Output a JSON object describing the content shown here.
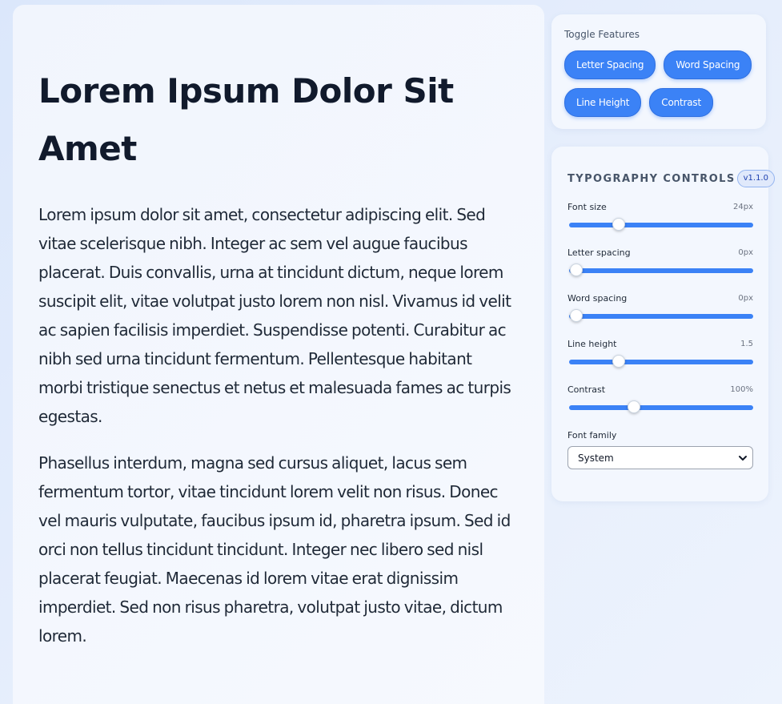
{
  "article": {
    "title": "Lorem Ipsum Dolor Sit Amet",
    "paragraphs": [
      "Lorem ipsum dolor sit amet, consectetur adipiscing elit. Sed vitae scelerisque nibh. Integer ac sem vel augue faucibus placerat. Duis convallis, urna at tincidunt dictum, neque lorem suscipit elit, vitae volutpat justo lorem non nisl. Vivamus id velit ac sapien facilisis imperdiet. Suspendisse potenti. Curabitur ac nibh sed urna tincidunt fermentum. Pellentesque habitant morbi tristique senectus et netus et malesuada fames ac turpis egestas.",
      "Phasellus interdum, magna sed cursus aliquet, lacus sem fermentum tortor, vitae tincidunt lorem velit non risus. Donec vel mauris vulputate, faucibus ipsum id, pharetra ipsum. Sed id orci non tellus tincidunt tincidunt. Integer nec libero sed nisl placerat feugiat. Maecenas id lorem vitae erat dignissim imperdiet. Sed non risus pharetra, volutpat justo vitae, dictum lorem."
    ]
  },
  "toggles": {
    "title": "Toggle Features",
    "buttons": [
      "Letter Spacing",
      "Word Spacing",
      "Line Height",
      "Contrast"
    ]
  },
  "controls": {
    "title": "TYPOGRAPHY CONTROLS",
    "version": "v1.1.0",
    "sliders": [
      {
        "label": "Font size",
        "value": "24px",
        "level": 0.27
      },
      {
        "label": "Letter spacing",
        "value": "0px",
        "level": 0.04
      },
      {
        "label": "Word spacing",
        "value": "0px",
        "level": 0.04
      },
      {
        "label": "Line height",
        "value": "1.5",
        "level": 0.27
      },
      {
        "label": "Contrast",
        "value": "100%",
        "level": 0.35
      }
    ],
    "font_family_label": "Font family",
    "font_family_value": "System"
  },
  "colors": {
    "accent": "#3b82f6",
    "heading": "#111a2c",
    "body_text": "#1f2937"
  },
  "icons": {
    "select_arrow": "chevron-down-icon"
  }
}
